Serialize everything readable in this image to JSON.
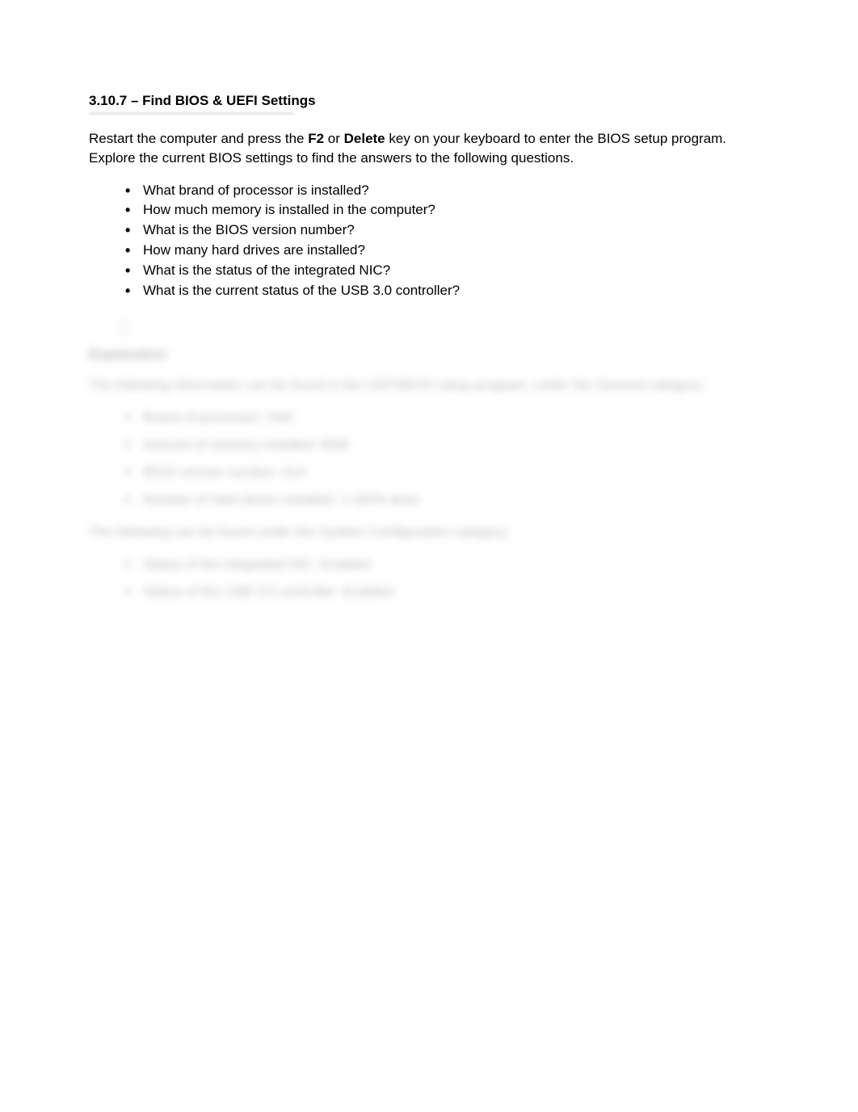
{
  "title": "3.10.7 – Find BIOS & UEFI Settings",
  "intro": {
    "pre": " Restart the computer and press the ",
    "key1": "F2",
    "mid": " or ",
    "key2": "Delete",
    "post": " key on your keyboard to enter the BIOS setup program. Explore the current BIOS settings to find the answers to the following questions."
  },
  "questions": [
    "What brand of processor is installed?",
    "How much memory is installed in the computer?",
    "What is the BIOS version number?",
    "How many hard drives are installed?",
    "What is the status of the integrated NIC?",
    "What is the current status of the USB 3.0 controller?"
  ],
  "explanation": {
    "label": "Explanation",
    "intro1": "The following information can be found in the UEFI/BIOS setup program, under the General category:",
    "answers1": [
      "Brand of processor: Intel",
      "Amount of memory installed: 8GB",
      "BIOS version number: A14",
      "Number of hard drives installed: 1 SATA drive"
    ],
    "intro2": "The following can be found under the System Configuration category:",
    "answers2": [
      "Status of the integrated NIC: Enabled",
      "Status of the USB 3.0 controller: Enabled"
    ]
  }
}
